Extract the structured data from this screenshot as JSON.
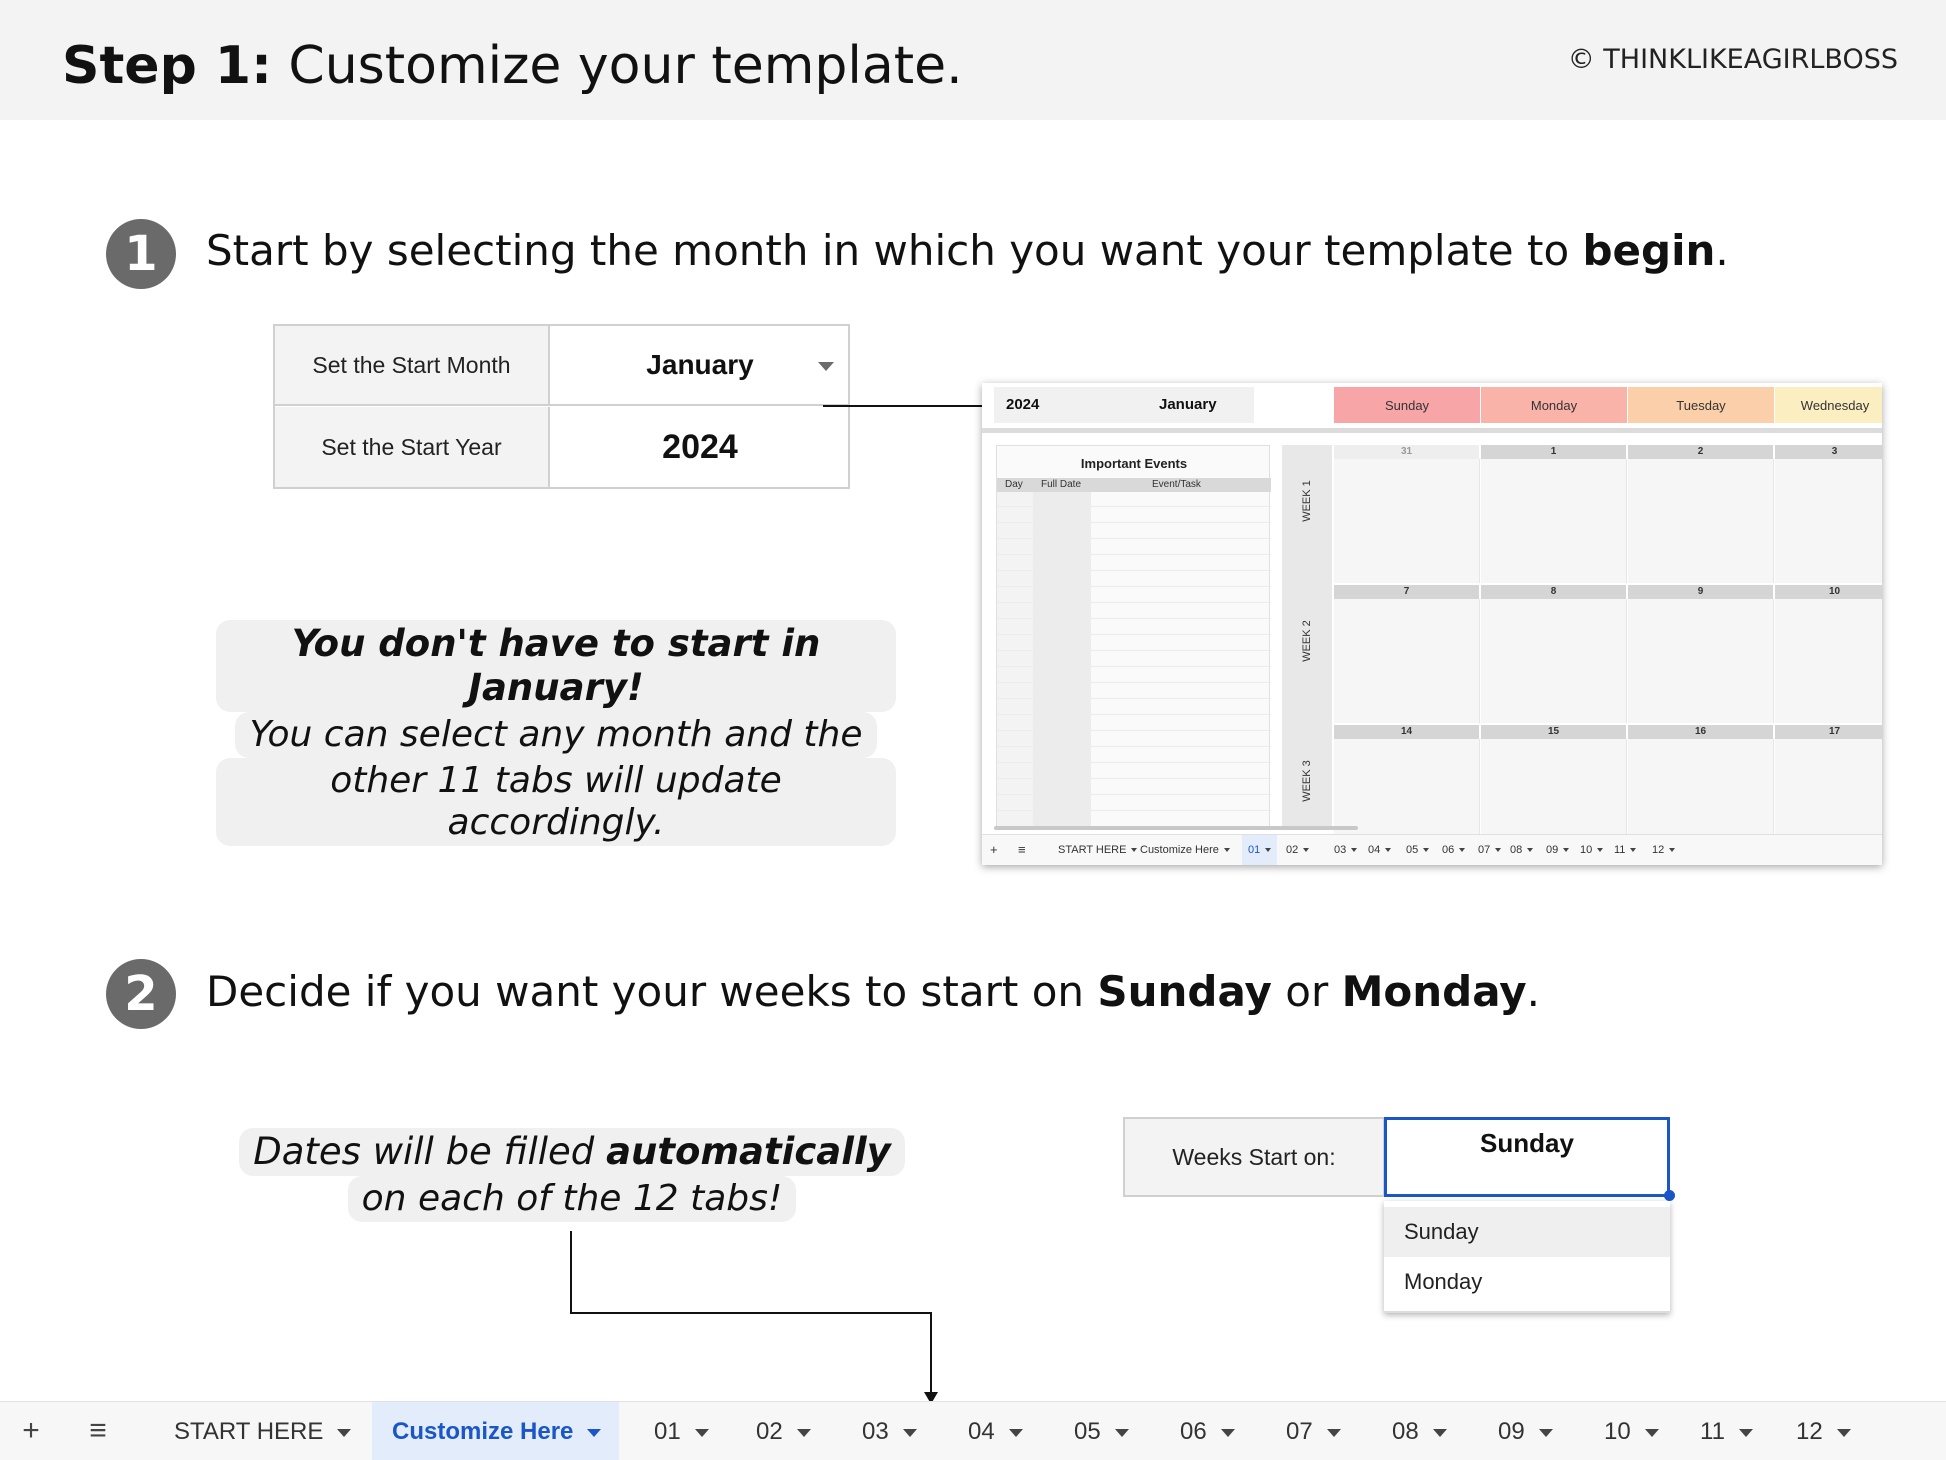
{
  "header": {
    "title_bold": "Step 1:",
    "title_rest": " Customize your template.",
    "copyright": "© THINKLIKEAGIRLBOSS"
  },
  "step1": {
    "number": "1",
    "text_pre": "Start by selecting the month in which you want your template to ",
    "text_bold": "begin",
    "text_post": "."
  },
  "settings": {
    "month_label": "Set the Start Month",
    "month_value": "January",
    "year_label": "Set the Start Year",
    "year_value": "2024"
  },
  "callout1": {
    "line1": "You don't have to start in January!",
    "line2": "You can select any month and the",
    "line3": "other 11 tabs will update accordingly."
  },
  "preview": {
    "year": "2024",
    "month": "January",
    "days": [
      "Sunday",
      "Monday",
      "Tuesday",
      "Wednesday"
    ],
    "day_colors": [
      "#f8a5a8",
      "#f9b3a8",
      "#fbcfa9",
      "#fbeec0"
    ],
    "events_title": "Important Events",
    "events_cols": [
      "Day",
      "Full Date",
      "Event/Task"
    ],
    "weeks": [
      "WEEK 1",
      "WEEK 2",
      "WEEK 3"
    ],
    "dates": [
      [
        "31",
        "1",
        "2",
        "3"
      ],
      [
        "7",
        "8",
        "9",
        "10"
      ],
      [
        "14",
        "15",
        "16",
        "17"
      ]
    ],
    "tabs": [
      "START HERE",
      "Customize Here",
      "01",
      "02",
      "03",
      "04",
      "05",
      "06",
      "07",
      "08",
      "09",
      "10",
      "11",
      "12"
    ],
    "active_tab": "01"
  },
  "step2": {
    "number": "2",
    "text_pre": "Decide if you want your weeks to start on ",
    "bold1": "Sunday",
    "text_mid": " or ",
    "bold2": "Monday",
    "text_post": "."
  },
  "callout2": {
    "line1_pre": "Dates will be filled ",
    "line1_bold": "automatically",
    "line2": "on each of the 12 tabs!"
  },
  "weeks_start": {
    "label": "Weeks Start on:",
    "value": "Sunday",
    "options": [
      "Sunday",
      "Monday"
    ]
  },
  "tabbar": {
    "add_icon": "plus-icon",
    "menu_icon": "hamburger-icon",
    "tabs": [
      "START HERE",
      "Customize Here",
      "01",
      "02",
      "03",
      "04",
      "05",
      "06",
      "07",
      "08",
      "09",
      "10",
      "11",
      "12"
    ],
    "active": "Customize Here",
    "accent": "#1a56c8"
  }
}
